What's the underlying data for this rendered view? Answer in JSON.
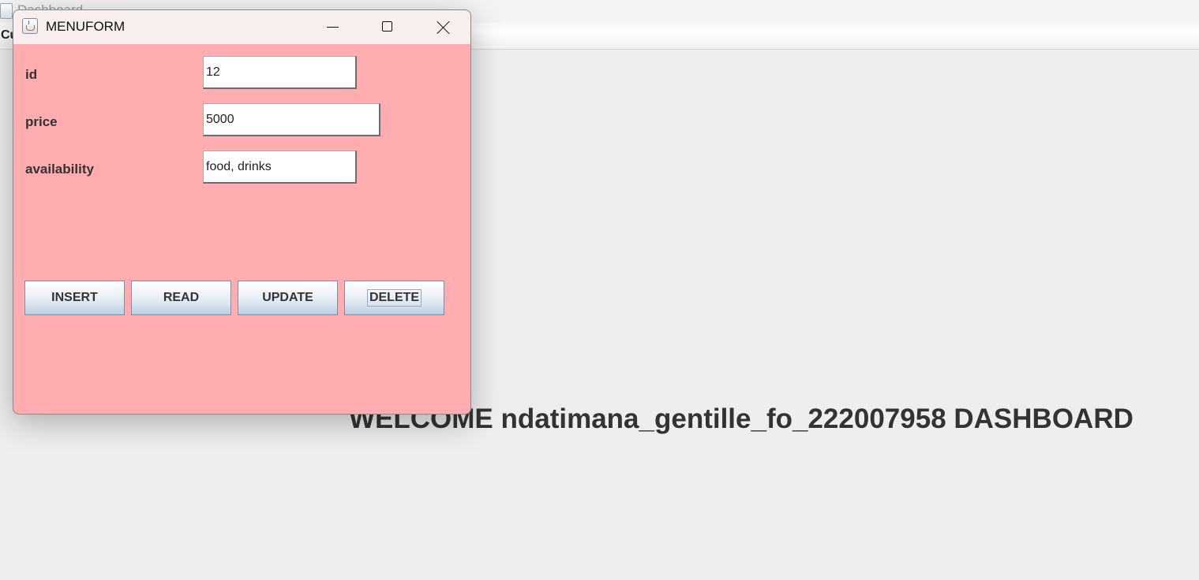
{
  "background_window": {
    "title": "Dashboard",
    "menu_item": "Cu",
    "welcome_text": "WELCOME ndatimana_gentille_fo_222007958 DASHBOARD"
  },
  "dialog": {
    "title": "MENUFORM",
    "background_color": "#ffadb0",
    "fields": {
      "id": {
        "label": "id",
        "value": "12"
      },
      "price": {
        "label": "price",
        "value": "5000"
      },
      "availability": {
        "label": "availability",
        "value": "food, drinks"
      }
    },
    "buttons": {
      "insert": "INSERT",
      "read": "READ",
      "update": "UPDATE",
      "delete": "DELETE"
    },
    "window_controls": {
      "minimize": "minimize-icon",
      "maximize": "maximize-icon",
      "close": "close-icon"
    }
  }
}
